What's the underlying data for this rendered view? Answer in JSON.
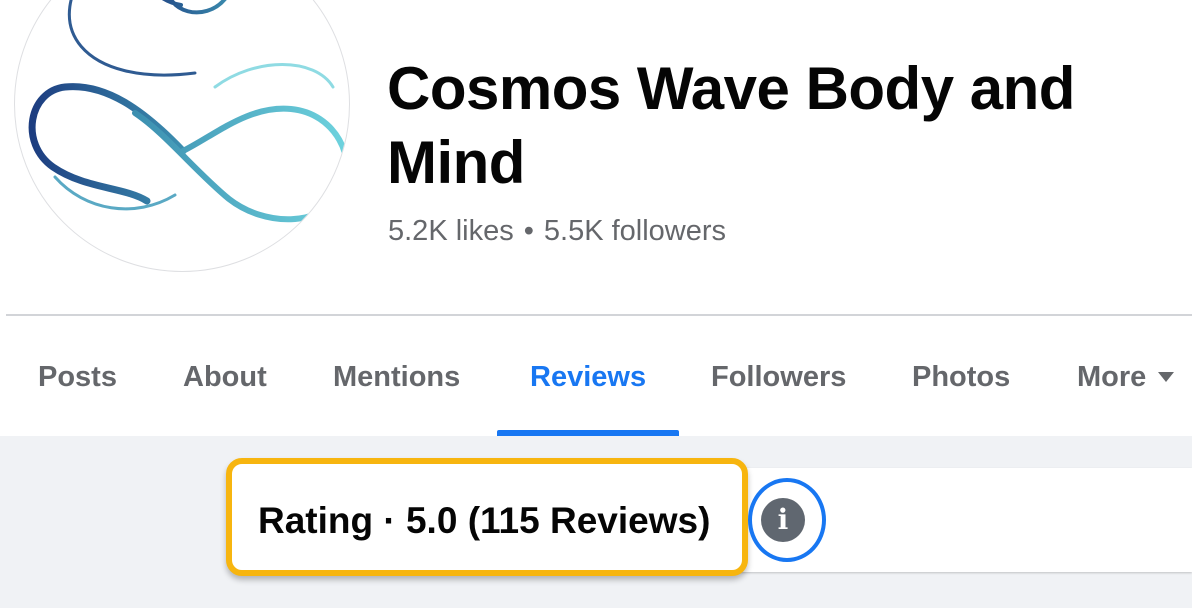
{
  "page": {
    "name": "Cosmos Wave Body and Mind",
    "likes": "5.2K likes",
    "separator": "•",
    "followers": "5.5K followers"
  },
  "tabs": [
    {
      "label": "Posts"
    },
    {
      "label": "About"
    },
    {
      "label": "Mentions"
    },
    {
      "label": "Reviews",
      "active": true
    },
    {
      "label": "Followers"
    },
    {
      "label": "Photos"
    },
    {
      "label": "More"
    }
  ],
  "reviews": {
    "rating_summary": "Rating · 5.0 (115 Reviews)",
    "info_icon": "i"
  },
  "colors": {
    "accent": "#1877f2",
    "highlight": "#f7b50f",
    "secondary_text": "#65676b",
    "background": "#f0f2f5"
  },
  "icons": {
    "info": "info-icon",
    "more_caret": "caret-down-icon",
    "logo": "infinity-wave-logo"
  }
}
